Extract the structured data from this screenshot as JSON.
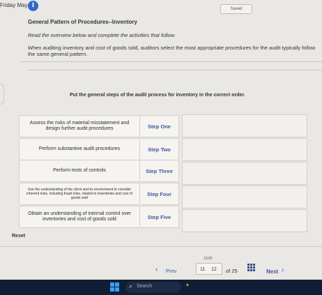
{
  "header": {
    "date": "Friday May 9",
    "info_icon": "i",
    "saved": "Saved"
  },
  "content": {
    "heading": "General Pattern of Procedures--Inventory",
    "instructions": "Read the overview below and complete the activities that follow.",
    "overview": "When auditing inventory and cost of goods sold, auditors select the most appropriate procedures for the audit typically follow the same general pattern.",
    "question": "Put the general steps of the audit process for inventory in the correct order."
  },
  "items": [
    {
      "text": "Assess the risks of material misstatement and design further audit procedures",
      "step": "Step One"
    },
    {
      "text": "Perform substantive audit procedures",
      "step": "Step Two"
    },
    {
      "text": "Perform tests of controls",
      "step": "Step Three"
    },
    {
      "text": "Use the understanding of the client and its environment to consider inherent risks, including fraud risks, related to inventories and cost of goods sold",
      "step": "Step Four"
    },
    {
      "text": "Obtain an understanding of internal control over inventories and cost of goods sold",
      "step": "Step Five"
    }
  ],
  "reset_label": "Reset",
  "pagination": {
    "prev": "Prev",
    "page_prev": "11",
    "page_current": "12",
    "current_marker": "12/25",
    "of_label": "of 25",
    "next": "Next"
  },
  "taskbar": {
    "search_placeholder": "Search"
  },
  "colors": {
    "accent": "#3c5a9a",
    "info": "#2f6cc9",
    "taskbar": "#0f1e34"
  }
}
